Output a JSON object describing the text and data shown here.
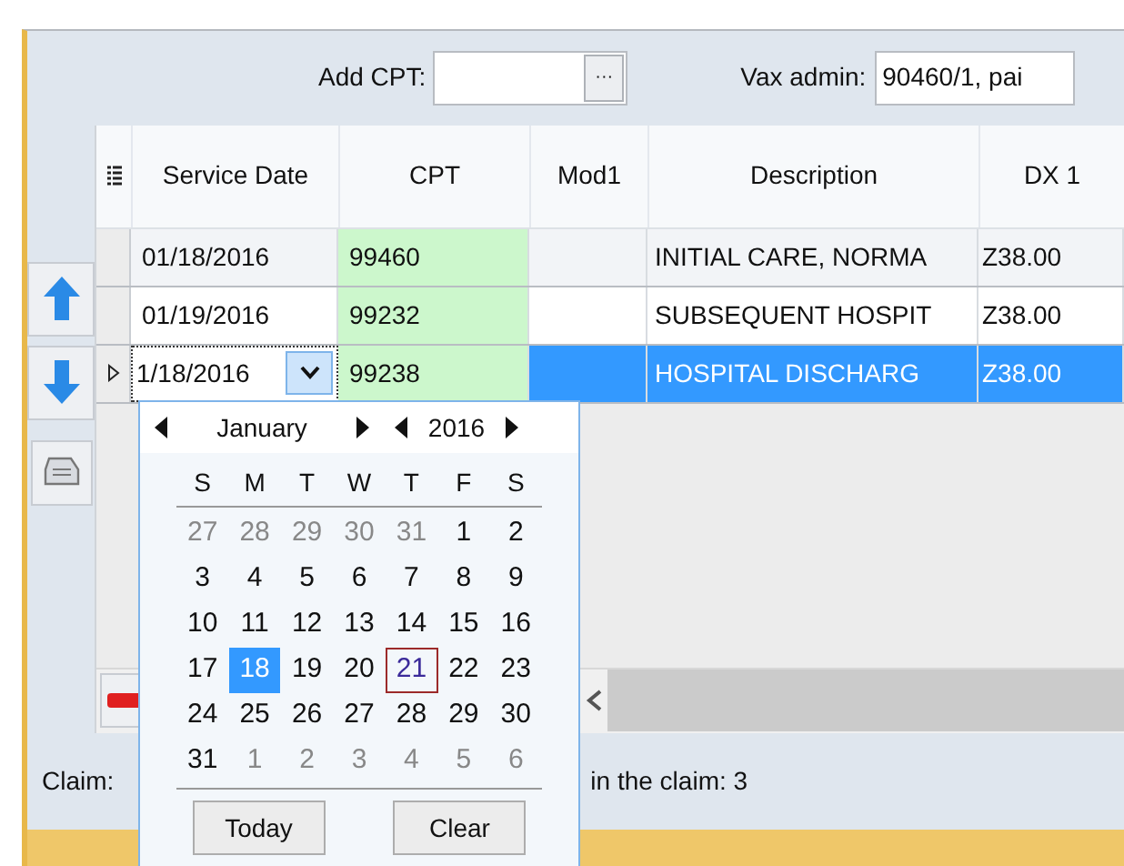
{
  "toolbar": {
    "add_cpt": {
      "label": "Add CPT:",
      "button": "···"
    },
    "vax_admin": {
      "label": "Vax admin:",
      "value": "90460/1, pai"
    }
  },
  "grid": {
    "columns": [
      "Service Date",
      "CPT",
      "Mod1",
      "Description",
      "DX 1"
    ],
    "rows": [
      {
        "selected": false,
        "current": false,
        "editing": false,
        "cells": [
          "01/18/2016",
          "99460",
          "",
          "INITIAL CARE, NORMA",
          "Z38.00"
        ]
      },
      {
        "selected": false,
        "current": false,
        "editing": false,
        "cells": [
          "01/19/2016",
          "99232",
          "",
          "SUBSEQUENT HOSPIT",
          "Z38.00"
        ]
      },
      {
        "selected": true,
        "current": true,
        "editing": true,
        "cells": [
          "1/18/2016",
          "99238",
          "",
          "HOSPITAL DISCHARG",
          "Z38.00"
        ]
      }
    ]
  },
  "calendar": {
    "month": "January",
    "year": "2016",
    "weekdays": [
      "S",
      "M",
      "T",
      "W",
      "T",
      "F",
      "S"
    ],
    "weeks": [
      [
        {
          "day": "27",
          "other": true
        },
        {
          "day": "28",
          "other": true
        },
        {
          "day": "29",
          "other": true
        },
        {
          "day": "30",
          "other": true
        },
        {
          "day": "31",
          "other": true
        },
        {
          "day": "1",
          "other": false
        },
        {
          "day": "2",
          "other": false
        }
      ],
      [
        {
          "day": "3",
          "other": false
        },
        {
          "day": "4",
          "other": false
        },
        {
          "day": "5",
          "other": false
        },
        {
          "day": "6",
          "other": false
        },
        {
          "day": "7",
          "other": false
        },
        {
          "day": "8",
          "other": false
        },
        {
          "day": "9",
          "other": false
        }
      ],
      [
        {
          "day": "10",
          "other": false
        },
        {
          "day": "11",
          "other": false
        },
        {
          "day": "12",
          "other": false
        },
        {
          "day": "13",
          "other": false
        },
        {
          "day": "14",
          "other": false
        },
        {
          "day": "15",
          "other": false
        },
        {
          "day": "16",
          "other": false
        }
      ],
      [
        {
          "day": "17",
          "other": false
        },
        {
          "day": "18",
          "other": false,
          "selected": true
        },
        {
          "day": "19",
          "other": false
        },
        {
          "day": "20",
          "other": false
        },
        {
          "day": "21",
          "other": false,
          "today": true
        },
        {
          "day": "22",
          "other": false
        },
        {
          "day": "23",
          "other": false
        }
      ],
      [
        {
          "day": "24",
          "other": false
        },
        {
          "day": "25",
          "other": false
        },
        {
          "day": "26",
          "other": false
        },
        {
          "day": "27",
          "other": false
        },
        {
          "day": "28",
          "other": false
        },
        {
          "day": "29",
          "other": false
        },
        {
          "day": "30",
          "other": false
        }
      ],
      [
        {
          "day": "31",
          "other": false
        },
        {
          "day": "1",
          "other": true
        },
        {
          "day": "2",
          "other": true
        },
        {
          "day": "3",
          "other": true
        },
        {
          "day": "4",
          "other": true
        },
        {
          "day": "5",
          "other": true
        },
        {
          "day": "6",
          "other": true
        }
      ]
    ],
    "buttons": [
      "Today",
      "Clear"
    ]
  },
  "status": {
    "claim_label": "Claim:",
    "lines_text": "in the claim: 3"
  }
}
